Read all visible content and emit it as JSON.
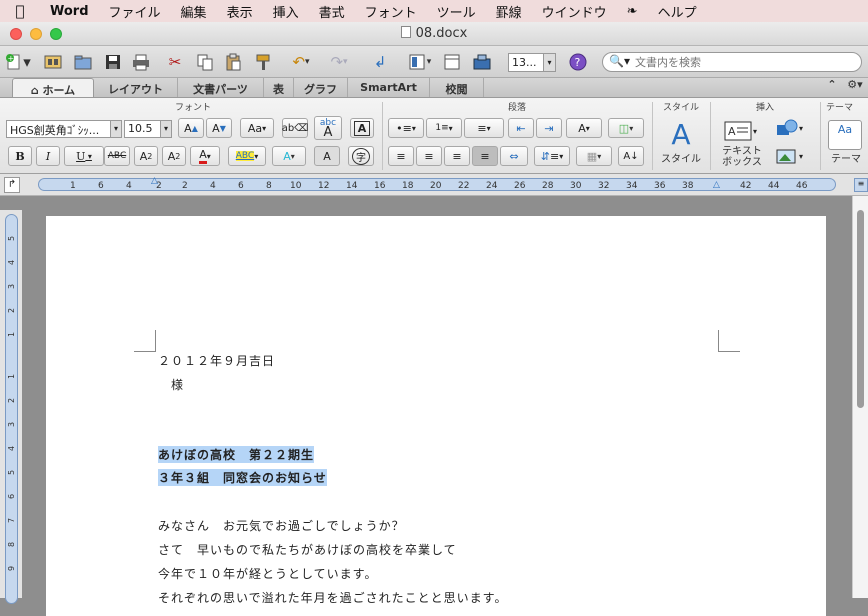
{
  "menubar": {
    "apple": "",
    "app": "Word",
    "items": [
      "ファイル",
      "編集",
      "表示",
      "挿入",
      "書式",
      "フォント",
      "ツール",
      "罫線",
      "ウインドウ",
      "ヘルプ"
    ]
  },
  "window": {
    "title": "08.docx"
  },
  "toolbar": {
    "zoom_value": "13...",
    "search_placeholder": "文書内を検索"
  },
  "ribbon_tabs": [
    {
      "label": "ホーム",
      "active": true
    },
    {
      "label": "レイアウト"
    },
    {
      "label": "文書パーツ"
    },
    {
      "label": "表"
    },
    {
      "label": "グラフ"
    },
    {
      "label": "SmartArt"
    },
    {
      "label": "校閲"
    }
  ],
  "ribbon": {
    "groups": {
      "font": "フォント",
      "paragraph": "段落",
      "styles": "スタイル",
      "insert": "挿入",
      "theme": "テーマ"
    },
    "font_name": "HGS創英角ｺﾞｼｯ...",
    "font_size": "10.5",
    "style_button": "スタイル",
    "textbox_line1": "テキスト",
    "textbox_line2": "ボックス",
    "theme_button": "テーマ"
  },
  "ruler": {
    "h_numbers": [
      "1",
      "6",
      "4",
      "2",
      "2",
      "4",
      "6",
      "8",
      "10",
      "12",
      "14",
      "16",
      "18",
      "20",
      "22",
      "24",
      "26",
      "28",
      "30",
      "32",
      "34",
      "36",
      "38",
      "42",
      "44",
      "46"
    ],
    "v_numbers": [
      "5",
      "4",
      "3",
      "2",
      "1",
      "1",
      "2",
      "3",
      "4",
      "5",
      "6",
      "7",
      "8",
      "9"
    ]
  },
  "document": {
    "lines": [
      {
        "text": "２０１２年９月吉日",
        "selected": false
      },
      {
        "text": "様",
        "selected": false
      },
      {
        "text": "",
        "selected": false
      },
      {
        "text": "あけぼの高校　第２２期生",
        "selected": true
      },
      {
        "text": "３年３組　同窓会のお知らせ",
        "selected": true
      },
      {
        "text": "",
        "selected": false
      },
      {
        "text": "みなさん　お元気でお過ごしでしょうか？",
        "selected": false
      },
      {
        "text": "さて　早いもので私たちがあけぼの高校を卒業して",
        "selected": false
      },
      {
        "text": "今年で１０年が経とうとしています。",
        "selected": false
      },
      {
        "text": "それぞれの思いで溢れた年月を過ごされたことと思います。",
        "selected": false
      }
    ]
  }
}
